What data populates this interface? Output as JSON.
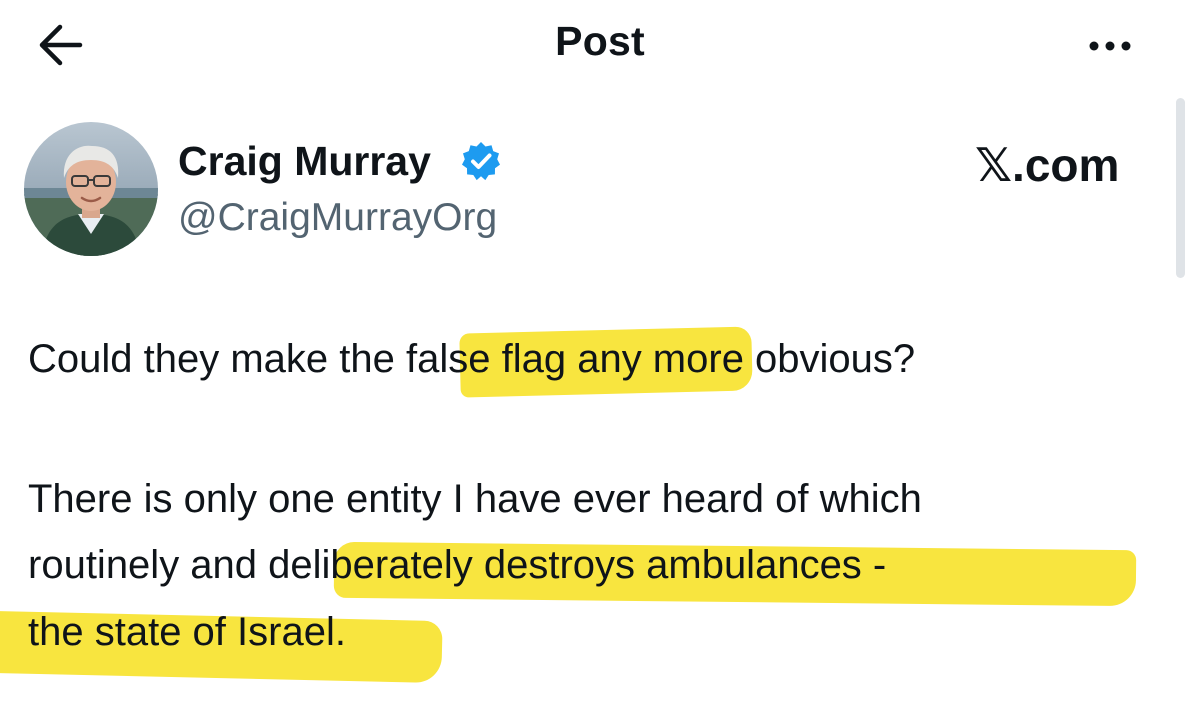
{
  "header": {
    "title": "Post",
    "back_icon": "arrow-left-icon",
    "more_icon": "more-horizontal-icon"
  },
  "post": {
    "author": {
      "display_name": "Craig Murray",
      "handle": "@CraigMurrayOrg",
      "verified": true,
      "verified_icon": "verified-badge-icon",
      "avatar_icon": "avatar"
    },
    "watermark": "𝕏.com",
    "body_lines": [
      "Could they make the false flag any more obvious?",
      "There is only one entity I have ever heard of which",
      "routinely and deliberately destroys ambulances -",
      "the state of Israel."
    ],
    "highlighted_phrases": [
      "e false flag an",
      "deliberately destroys ambulances -",
      "the state of Israel."
    ]
  },
  "colors": {
    "text_primary": "#0f1419",
    "text_secondary": "#536471",
    "verified_blue": "#1d9bf0",
    "highlight_yellow": "#f8e53f",
    "background": "#ffffff"
  }
}
